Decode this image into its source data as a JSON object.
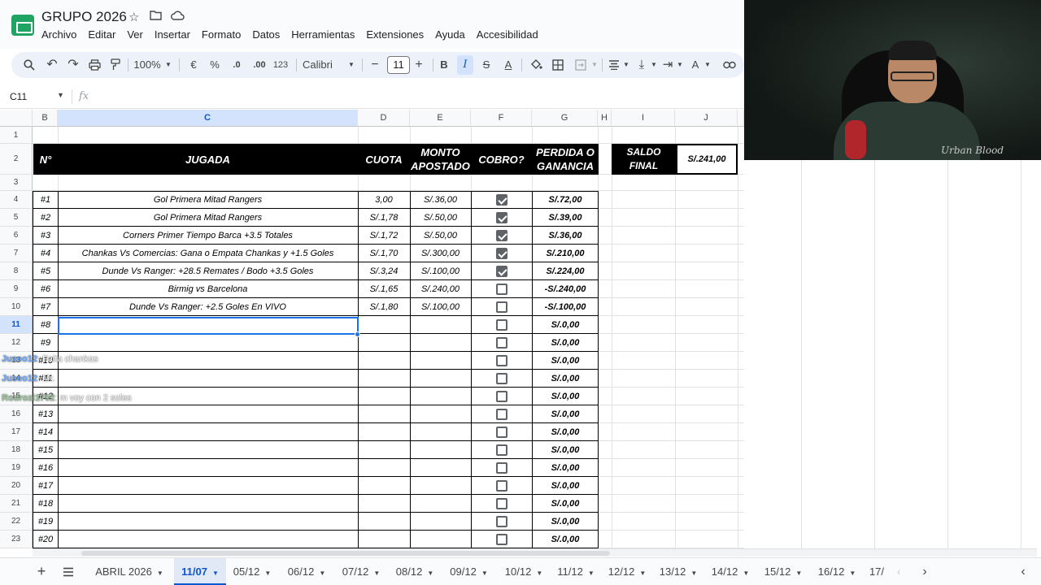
{
  "app": {
    "doc_title": "GRUPO 2026",
    "menu": [
      "Archivo",
      "Editar",
      "Ver",
      "Insertar",
      "Formato",
      "Datos",
      "Herramientas",
      "Extensiones",
      "Ayuda",
      "Accesibilidad"
    ]
  },
  "toolbar": {
    "zoom": "100%",
    "currency": "€",
    "percent": "%",
    "dec_decrease": ".0",
    "dec_increase": ".00",
    "number_format": "123",
    "font": "Calibri",
    "font_size": "11",
    "bold": "B",
    "italic": "I",
    "strike": "S",
    "text_color": "A",
    "minus": "−",
    "plus": "+"
  },
  "formula_bar": {
    "name_box": "C11",
    "fx": "fx",
    "value": ""
  },
  "columns": [
    "B",
    "C",
    "D",
    "E",
    "F",
    "G",
    "H",
    "I",
    "J"
  ],
  "rows": [
    "1",
    "2",
    "3",
    "4",
    "5",
    "6",
    "7",
    "8",
    "9",
    "10",
    "11",
    "12",
    "13",
    "14",
    "15",
    "16",
    "17",
    "18",
    "19",
    "20",
    "21",
    "22",
    "23"
  ],
  "table": {
    "headers": {
      "num": "N°",
      "jugada": "JUGADA",
      "cuota": "CUOTA",
      "monto": "MONTO APOSTADO",
      "cobro": "COBRO?",
      "resultado": "PERDIDA O GANANCIA"
    },
    "saldo_label": "SALDO FINAL",
    "saldo_value": "S/.241,00",
    "bets": [
      {
        "num": "#1",
        "jugada": "Gol Primera Mitad Rangers",
        "cuota": "3,00",
        "monto": "S/.36,00",
        "cobro": true,
        "resultado": "S/.72,00"
      },
      {
        "num": "#2",
        "jugada": "Gol Primera Mitad Rangers",
        "cuota": "S/.1,78",
        "monto": "S/.50,00",
        "cobro": true,
        "resultado": "S/.39,00"
      },
      {
        "num": "#3",
        "jugada": "Corners Primer Tiempo Barca +3.5 Totales",
        "cuota": "S/.1,72",
        "monto": "S/.50,00",
        "cobro": true,
        "resultado": "S/.36,00"
      },
      {
        "num": "#4",
        "jugada": "Chankas Vs Comercias: Gana o Empata Chankas y +1.5  Goles",
        "cuota": "S/.1,70",
        "monto": "S/.300,00",
        "cobro": true,
        "resultado": "S/.210,00"
      },
      {
        "num": "#5",
        "jugada": "Dunde Vs Ranger: +28.5 Remates / Bodo +3.5 Goles",
        "cuota": "S/.3,24",
        "monto": "S/.100,00",
        "cobro": true,
        "resultado": "S/.224,00"
      },
      {
        "num": "#6",
        "jugada": "Birmig vs Barcelona",
        "cuota": "S/.1,65",
        "monto": "S/.240,00",
        "cobro": false,
        "resultado": "-S/.240,00"
      },
      {
        "num": "#7",
        "jugada": "Dunde Vs Ranger: +2.5 Goles En VIVO",
        "cuota": "S/.1,80",
        "monto": "S/.100,00",
        "cobro": false,
        "resultado": "-S/.100,00"
      },
      {
        "num": "#8",
        "jugada": "",
        "cuota": "",
        "monto": "",
        "cobro": false,
        "resultado": "S/.0,00"
      },
      {
        "num": "#9",
        "jugada": "",
        "cuota": "",
        "monto": "",
        "cobro": false,
        "resultado": "S/.0,00"
      },
      {
        "num": "#10",
        "jugada": "",
        "cuota": "",
        "monto": "",
        "cobro": false,
        "resultado": "S/.0,00"
      },
      {
        "num": "#11",
        "jugada": "",
        "cuota": "",
        "monto": "",
        "cobro": false,
        "resultado": "S/.0,00"
      },
      {
        "num": "#12",
        "jugada": "",
        "cuota": "",
        "monto": "",
        "cobro": false,
        "resultado": "S/.0,00"
      },
      {
        "num": "#13",
        "jugada": "",
        "cuota": "",
        "monto": "",
        "cobro": false,
        "resultado": "S/.0,00"
      },
      {
        "num": "#14",
        "jugada": "",
        "cuota": "",
        "monto": "",
        "cobro": false,
        "resultado": "S/.0,00"
      },
      {
        "num": "#15",
        "jugada": "",
        "cuota": "",
        "monto": "",
        "cobro": false,
        "resultado": "S/.0,00"
      },
      {
        "num": "#16",
        "jugada": "",
        "cuota": "",
        "monto": "",
        "cobro": false,
        "resultado": "S/.0,00"
      },
      {
        "num": "#17",
        "jugada": "",
        "cuota": "",
        "monto": "",
        "cobro": false,
        "resultado": "S/.0,00"
      },
      {
        "num": "#18",
        "jugada": "",
        "cuota": "",
        "monto": "",
        "cobro": false,
        "resultado": "S/.0,00"
      },
      {
        "num": "#19",
        "jugada": "",
        "cuota": "",
        "monto": "",
        "cobro": false,
        "resultado": "S/.0,00"
      },
      {
        "num": "#20",
        "jugada": "",
        "cuota": "",
        "monto": "",
        "cobro": false,
        "resultado": "S/.0,00"
      }
    ]
  },
  "chat": [
    {
      "user": "Juseo12",
      "text": ": Falta chankas"
    },
    {
      "user": "Juseo12",
      "text": ": Mr."
    },
    {
      "user": "Rodrozi1702",
      "text": ": m voy con 2 soles"
    }
  ],
  "webcam": {
    "shirt_text": "Urban Blood"
  },
  "sheets": {
    "tabs": [
      "ABRIL 2026",
      "11/07",
      "05/12",
      "06/12",
      "07/12",
      "08/12",
      "09/12",
      "10/12",
      "11/12",
      "12/12",
      "13/12",
      "14/12",
      "15/12",
      "16/12",
      "17/"
    ],
    "active": "11/07"
  },
  "colors": {
    "accent": "#1a73e8",
    "header_bg": "#000000",
    "sheets_green": "#1fa463"
  }
}
